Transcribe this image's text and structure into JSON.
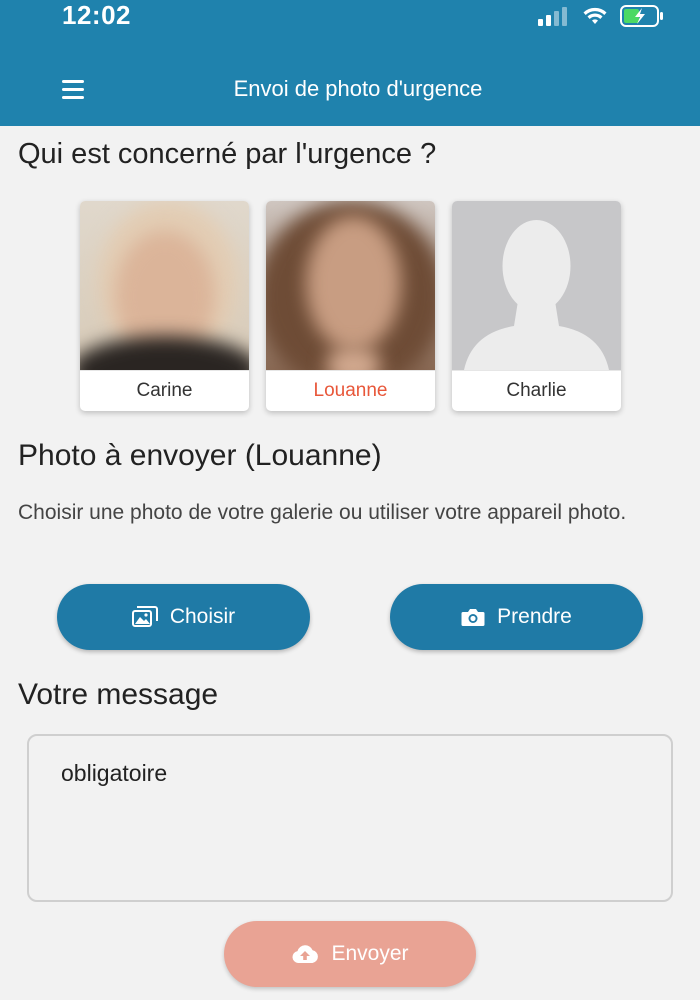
{
  "status": {
    "time": "12:02"
  },
  "header": {
    "title": "Envoi de photo d'urgence",
    "menu_icon": "hamburger-menu-icon",
    "color": "#1f82ad"
  },
  "section_person": {
    "title": "Qui est concerné par l'urgence ?",
    "people": [
      {
        "name": "Carine",
        "selected": false
      },
      {
        "name": "Louanne",
        "selected": true
      },
      {
        "name": "Charlie",
        "selected": false
      }
    ]
  },
  "section_photo": {
    "title": "Photo à envoyer (Louanne)",
    "description": "Choisir une photo de votre galerie ou utiliser votre appareil photo.",
    "choose_label": "Choisir",
    "take_label": "Prendre"
  },
  "section_message": {
    "title": "Votre message",
    "placeholder": "obligatoire"
  },
  "send_label": "Envoyer",
  "colors": {
    "primary": "#1f7aa6",
    "accent": "#e8573a",
    "send_disabled": "#e9a394"
  }
}
